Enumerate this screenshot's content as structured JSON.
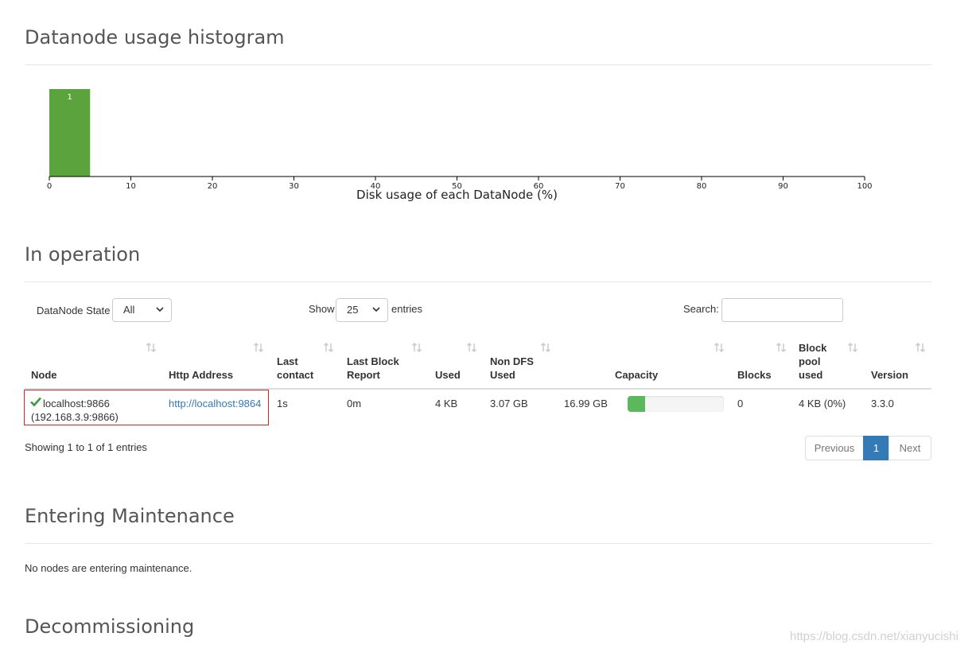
{
  "histogram": {
    "title": "Datanode usage histogram",
    "xlabel": "Disk usage of each DataNode (%)",
    "bar_label": "1"
  },
  "chart_data": {
    "type": "bar",
    "title": "Datanode usage histogram",
    "xlabel": "Disk usage of each DataNode (%)",
    "ylabel": "",
    "xlim": [
      0,
      100
    ],
    "x_ticks": [
      "0",
      "10",
      "20",
      "30",
      "40",
      "50",
      "60",
      "70",
      "80",
      "90",
      "100"
    ],
    "bins": [
      {
        "from": 0,
        "to": 5,
        "count": 1
      }
    ]
  },
  "in_operation": {
    "title": "In operation",
    "state_label": "DataNode State",
    "state_value": "All",
    "show_label": "Show",
    "show_value": "25",
    "entries_label": "entries",
    "search_label": "Search:",
    "search_value": "",
    "headers": {
      "node": "Node",
      "http": "Http Address",
      "last_contact_1": "Last",
      "last_contact_2": "contact",
      "last_block_1": "Last Block",
      "last_block_2": "Report",
      "used": "Used",
      "non_dfs_1": "Non DFS",
      "non_dfs_2": "Used",
      "capacity": "Capacity",
      "blocks": "Blocks",
      "bp_1": "Block",
      "bp_2": "pool",
      "bp_3": "used",
      "version": "Version"
    },
    "row": {
      "node_name": "localhost:9866",
      "node_ip": "(192.168.3.9:9866)",
      "http_address": "http://localhost:9864",
      "last_contact": "1s",
      "last_block_report": "0m",
      "used": "4 KB",
      "non_dfs_used": "3.07 GB",
      "capacity": "16.99 GB",
      "capacity_used_fraction": 0.18,
      "blocks": "0",
      "block_pool_used": "4 KB (0%)",
      "version": "3.3.0"
    },
    "showing": "Showing 1 to 1 of 1 entries",
    "pager": {
      "previous": "Previous",
      "page": "1",
      "next": "Next"
    }
  },
  "maintenance": {
    "title": "Entering Maintenance",
    "empty_text": "No nodes are entering maintenance."
  },
  "decommissioning": {
    "title": "Decommissioning"
  },
  "watermark": "https://blog.csdn.net/xianyucishi",
  "colors": {
    "bar": "#5ba33c",
    "progress": "#5cb85c",
    "active_page": "#337ab7",
    "link": "#337ab7",
    "highlight_border": "#d9232a"
  }
}
